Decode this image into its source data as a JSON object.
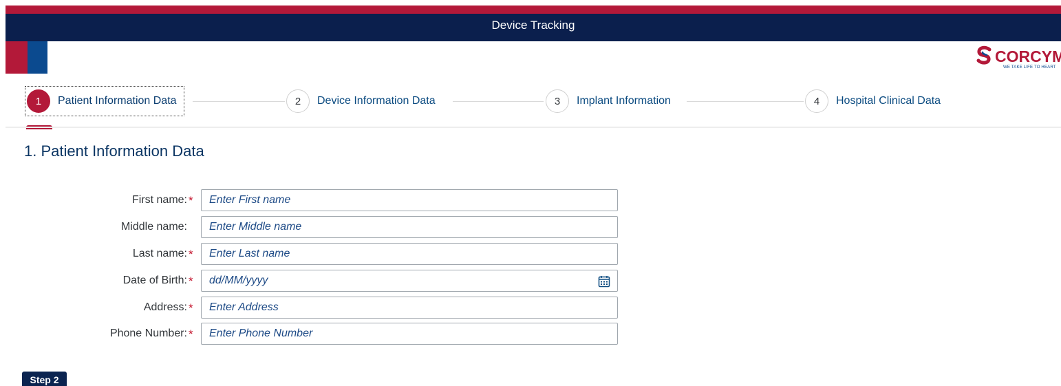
{
  "header": {
    "title": "Device Tracking"
  },
  "logo": {
    "name": "CORCYM",
    "tagline": "WE TAKE LIFE TO HEART"
  },
  "wizard": {
    "steps": [
      {
        "number": "1",
        "label": "Patient Information Data"
      },
      {
        "number": "2",
        "label": "Device Information Data"
      },
      {
        "number": "3",
        "label": "Implant Information"
      },
      {
        "number": "4",
        "label": "Hospital Clinical Data"
      }
    ],
    "active_step": 1
  },
  "section": {
    "title": "1. Patient Information Data"
  },
  "form": {
    "fields": [
      {
        "label": "First name:",
        "required": true,
        "placeholder": "Enter First name"
      },
      {
        "label": "Middle name:",
        "required": false,
        "placeholder": "Enter Middle name"
      },
      {
        "label": "Last name:",
        "required": true,
        "placeholder": "Enter Last name"
      },
      {
        "label": "Date of Birth:",
        "required": true,
        "placeholder": "dd/MM/yyyy"
      },
      {
        "label": "Address:",
        "required": true,
        "placeholder": "Enter Address"
      },
      {
        "label": "Phone Number:",
        "required": true,
        "placeholder": "Enter Phone Number"
      }
    ],
    "required_mark": "*",
    "date_icon": "calendar-icon"
  },
  "actions": {
    "next_label": "Step 2"
  },
  "colors": {
    "brand_red": "#b31939",
    "brand_navy": "#0b1f4d",
    "link_blue": "#0a4a80"
  }
}
